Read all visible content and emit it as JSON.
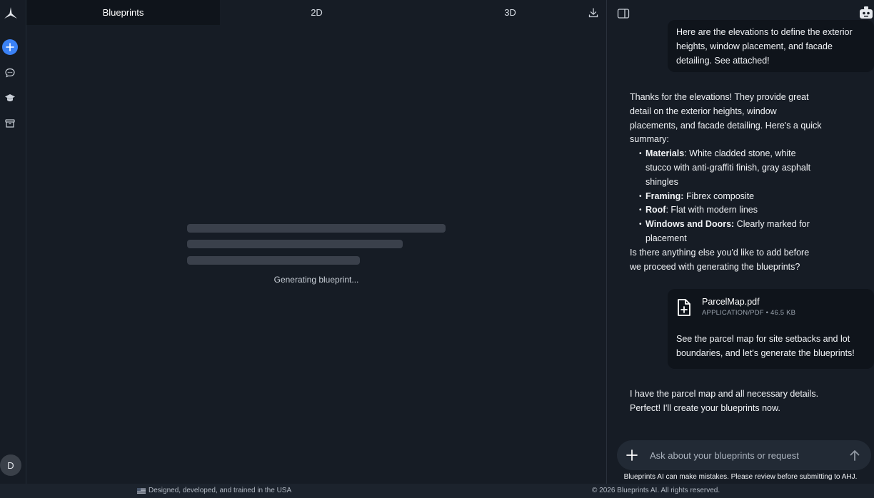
{
  "sidebar": {
    "new_label": "+",
    "avatar_initial": "D"
  },
  "tabs": [
    {
      "label": "Blueprints",
      "active": true
    },
    {
      "label": "2D",
      "active": false
    },
    {
      "label": "3D",
      "active": false
    }
  ],
  "main": {
    "loading_text": "Generating blueprint..."
  },
  "chat": {
    "messages": {
      "user1": "Here are the elevations to define the exterior heights, window placement, and facade detailing. See attached!",
      "assistant1": {
        "intro": "Thanks for the elevations! They provide great detail on the exterior heights, window placements, and facade detailing. Here's a quick summary:",
        "items": [
          {
            "label": "Materials",
            "text": ": White cladded stone, white stucco with anti-graffiti finish, gray asphalt shingles"
          },
          {
            "label": "Framing:",
            "text": " Fibrex composite"
          },
          {
            "label": "Roof",
            "text": ": Flat with modern lines"
          },
          {
            "label": "Windows and Doors:",
            "text": " Clearly marked for placement"
          }
        ],
        "outro": "Is there anything else you'd like to add before we proceed with generating the blueprints?"
      },
      "user2": {
        "file_name": "ParcelMap.pdf",
        "file_meta": "APPLICATION/PDF • 46.5 KB",
        "text": "See the parcel map for site setbacks and lot boundaries, and let's generate the blueprints!"
      },
      "assistant2": "I have the parcel map and all necessary details. Perfect! I'll create your blueprints now."
    },
    "input_placeholder": "Ask about your blueprints or request",
    "disclaimer": "Blueprints AI can make mistakes. Please review before submitting to AHJ."
  },
  "footer": {
    "left": "Designed, developed, and trained in the USA",
    "right": "© 2026 Blueprints AI. All rights reserved."
  },
  "colors": {
    "background": "#161c25",
    "accent": "#3b82f6",
    "bubble": "#0f141b",
    "skeleton": "#3a404b"
  },
  "icons": [
    "app-logo-icon",
    "plus-icon",
    "chat-icon",
    "graduation-cap-icon",
    "archive-icon",
    "download-icon",
    "panel-toggle-icon",
    "robot-icon",
    "file-plus-icon",
    "arrow-up-icon"
  ]
}
